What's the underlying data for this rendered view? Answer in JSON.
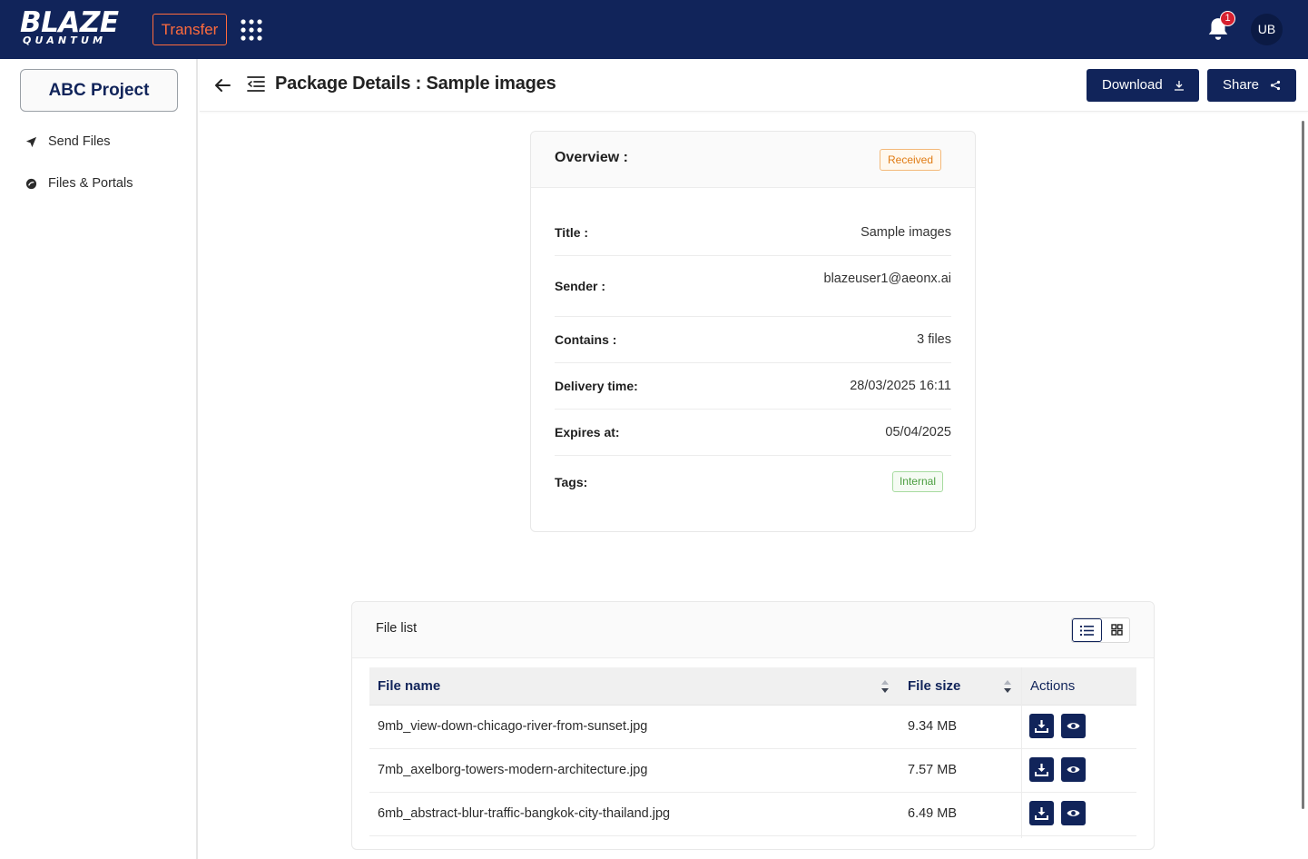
{
  "brand": {
    "name": "BLAZE",
    "sub": "QUANTUM"
  },
  "topbar": {
    "transfer_label": "Transfer",
    "notification_count": "1",
    "avatar_initials": "UB"
  },
  "sidebar": {
    "project_label": "ABC Project",
    "items": [
      {
        "label": "Send Files",
        "icon": "send-icon"
      },
      {
        "label": "Files & Portals",
        "icon": "portal-icon"
      }
    ]
  },
  "header": {
    "title": "Package Details : Sample images",
    "download_label": "Download",
    "share_label": "Share"
  },
  "overview": {
    "title": "Overview :",
    "status": "Received",
    "rows": [
      {
        "key": "Title :",
        "value": "Sample images"
      },
      {
        "key": "Sender :",
        "value": "blazeuser1@aeonx.ai"
      },
      {
        "key": "Contains :",
        "value": "3 files"
      },
      {
        "key": "Delivery time:",
        "value": "28/03/2025 16:11"
      },
      {
        "key": "Expires at:",
        "value": "05/04/2025"
      },
      {
        "key": "Tags:",
        "value": "Internal"
      }
    ]
  },
  "file_list": {
    "title": "File list",
    "columns": {
      "name": "File name",
      "size": "File size",
      "actions": "Actions"
    },
    "files": [
      {
        "name": "9mb_view-down-chicago-river-from-sunset.jpg",
        "size": "9.34 MB"
      },
      {
        "name": "7mb_axelborg-towers-modern-architecture.jpg",
        "size": "7.57 MB"
      },
      {
        "name": "6mb_abstract-blur-traffic-bangkok-city-thailand.jpg",
        "size": "6.49 MB"
      }
    ]
  },
  "colors": {
    "navy": "#11245a",
    "accent": "#ff6b3d",
    "status_orange": "#e07b13",
    "tag_green": "#4a9d3e"
  }
}
